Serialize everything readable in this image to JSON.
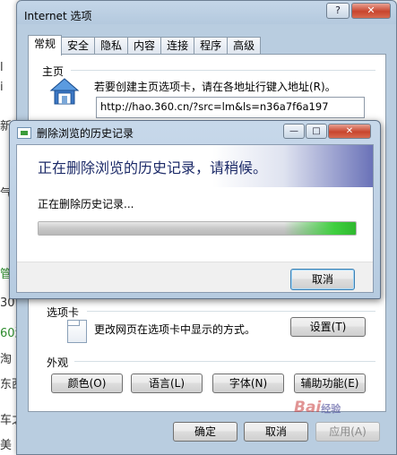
{
  "background": {
    "fragments": [
      "l",
      "i",
      "新",
      "气",
      "管",
      "30",
      "60游",
      "淘",
      "东西",
      "车之",
      "美 扌"
    ]
  },
  "dialog": {
    "title": "Internet 选项",
    "help_label": "?",
    "close_label": "✕",
    "tabs": [
      {
        "label": "常规",
        "active": true
      },
      {
        "label": "安全",
        "active": false
      },
      {
        "label": "隐私",
        "active": false
      },
      {
        "label": "内容",
        "active": false
      },
      {
        "label": "连接",
        "active": false
      },
      {
        "label": "程序",
        "active": false
      },
      {
        "label": "高级",
        "active": false
      }
    ],
    "homepage": {
      "group_label": "主页",
      "description": "若要创建主页选项卡，请在各地址行键入地址(R)。",
      "address": "http://hao.360.cn/?src=lm&ls=n36a7f6a197",
      "icon": "home-icon"
    },
    "tabs_section": {
      "group_label": "选项卡",
      "description": "更改网页在选项卡中显示的方式。",
      "settings_label": "设置(T)",
      "icon": "tabs-icon"
    },
    "appearance": {
      "group_label": "外观",
      "buttons": [
        "颜色(O)",
        "语言(L)",
        "字体(N)",
        "辅助功能(E)"
      ]
    },
    "footer": {
      "ok_label": "确定",
      "cancel_label": "取消",
      "apply_label": "应用(A)"
    }
  },
  "delete_dialog": {
    "title": "删除浏览的历史记录",
    "header": "正在删除浏览的历史记录，请稍候。",
    "status": "正在删除历史记录...",
    "progress": 1.0,
    "cancel_label": "取消",
    "min_label": "—",
    "max_label": "□",
    "close_label": "✕"
  },
  "watermark": {
    "text": "Bai",
    "suffix": "经验"
  },
  "colors": {
    "title_bar": "#b9cde0",
    "header_text": "#1c2a68",
    "progress_green": "#3fcf3f",
    "close_red": "#c8452e"
  }
}
